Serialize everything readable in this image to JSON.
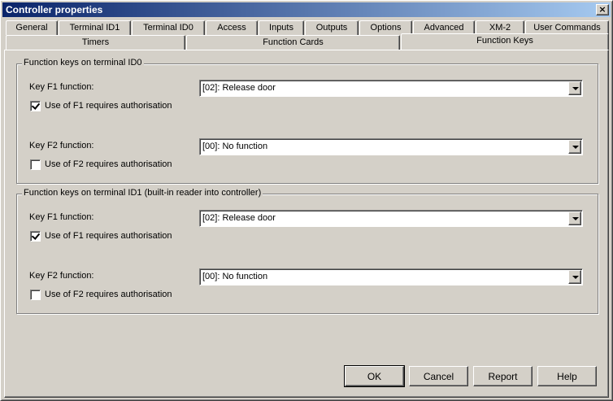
{
  "window": {
    "title": "Controller properties",
    "close_glyph": "×"
  },
  "tabs_row1": [
    "General",
    "Terminal ID1",
    "Terminal ID0",
    "Access",
    "Inputs",
    "Outputs",
    "Options",
    "Advanced",
    "XM-2",
    "User Commands"
  ],
  "tabs_row2": [
    "Timers",
    "Function Cards",
    "Function Keys"
  ],
  "selected_tab": "Function Keys",
  "groups": [
    {
      "title": "Function keys on terminal ID0",
      "f1_label": "Key F1 function:",
      "f1_value": "[02]: Release door",
      "f1_auth_label": "Use of F1 requires authorisation",
      "f1_auth_checked": true,
      "f2_label": "Key F2 function:",
      "f2_value": "[00]: No function",
      "f2_auth_label": "Use of F2 requires authorisation",
      "f2_auth_checked": false
    },
    {
      "title": "Function keys on terminal ID1 (built-in reader into controller)",
      "f1_label": "Key F1 function:",
      "f1_value": "[02]: Release door",
      "f1_auth_label": "Use of F1 requires authorisation",
      "f1_auth_checked": true,
      "f2_label": "Key F2 function:",
      "f2_value": "[00]: No function",
      "f2_auth_label": "Use of F2 requires authorisation",
      "f2_auth_checked": false
    }
  ],
  "buttons": {
    "ok": "OK",
    "cancel": "Cancel",
    "report": "Report",
    "help": "Help"
  },
  "colors": {
    "face": "#d4d0c8",
    "title_start": "#0a246a",
    "title_end": "#a6caf0"
  }
}
